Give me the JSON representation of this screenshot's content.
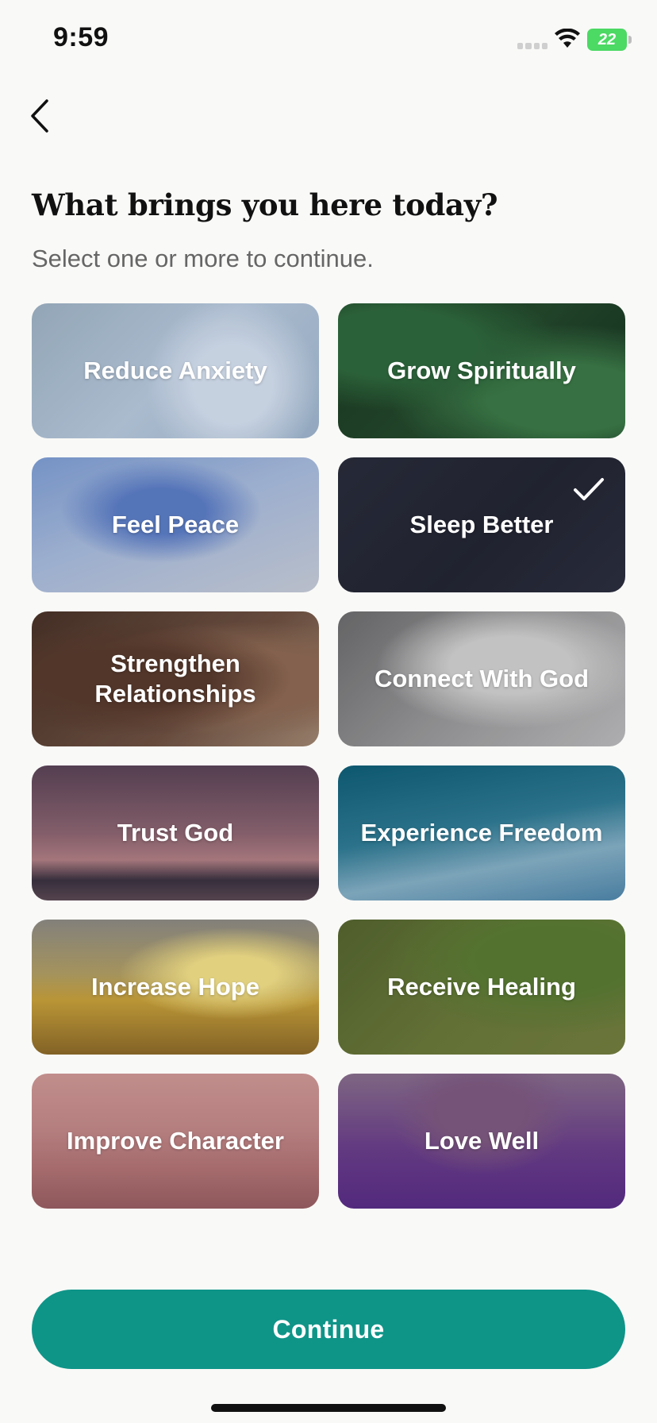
{
  "status_bar": {
    "time": "9:59",
    "battery": "22"
  },
  "header": {
    "back_icon": "chevron-left-icon"
  },
  "title": "What brings you here today?",
  "subtitle": "Select one or more to continue.",
  "options": [
    {
      "label": "Reduce Anxiety",
      "selected": false
    },
    {
      "label": "Grow Spiritually",
      "selected": false
    },
    {
      "label": "Feel Peace",
      "selected": false
    },
    {
      "label": "Sleep Better",
      "selected": true
    },
    {
      "label": "Strengthen Relationships",
      "selected": false
    },
    {
      "label": "Connect With God",
      "selected": false
    },
    {
      "label": "Trust God",
      "selected": false
    },
    {
      "label": "Experience Freedom",
      "selected": false
    },
    {
      "label": "Increase Hope",
      "selected": false
    },
    {
      "label": "Receive Healing",
      "selected": false
    },
    {
      "label": "Improve Character",
      "selected": false
    },
    {
      "label": "Love Well",
      "selected": false
    }
  ],
  "continue_label": "Continue",
  "colors": {
    "accent": "#0f9488",
    "battery": "#4cd964"
  }
}
